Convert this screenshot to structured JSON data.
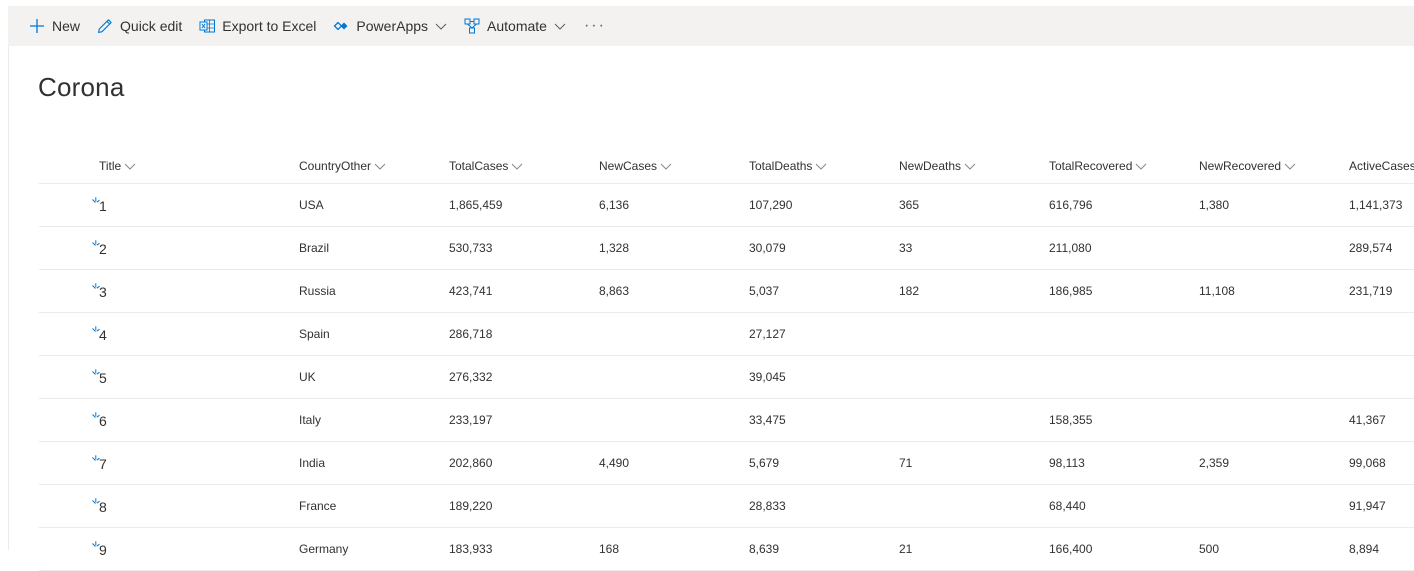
{
  "toolbar": {
    "new_label": "New",
    "quick_edit_label": "Quick edit",
    "export_label": "Export to Excel",
    "powerapps_label": "PowerApps",
    "automate_label": "Automate",
    "more_label": "···"
  },
  "list": {
    "title": "Corona",
    "columns": [
      "Title",
      "CountryOther",
      "TotalCases",
      "NewCases",
      "TotalDeaths",
      "NewDeaths",
      "TotalRecovered",
      "NewRecovered",
      "ActiveCases"
    ],
    "rows": [
      {
        "title": "1",
        "country": "USA",
        "total_cases": "1,865,459",
        "new_cases": "6,136",
        "total_deaths": "107,290",
        "new_deaths": "365",
        "total_recovered": "616,796",
        "new_recovered": "1,380",
        "active_cases": "1,141,373"
      },
      {
        "title": "2",
        "country": "Brazil",
        "total_cases": "530,733",
        "new_cases": "1,328",
        "total_deaths": "30,079",
        "new_deaths": "33",
        "total_recovered": "211,080",
        "new_recovered": "",
        "active_cases": "289,574"
      },
      {
        "title": "3",
        "country": "Russia",
        "total_cases": "423,741",
        "new_cases": "8,863",
        "total_deaths": "5,037",
        "new_deaths": "182",
        "total_recovered": "186,985",
        "new_recovered": "11,108",
        "active_cases": "231,719"
      },
      {
        "title": "4",
        "country": "Spain",
        "total_cases": "286,718",
        "new_cases": "",
        "total_deaths": "27,127",
        "new_deaths": "",
        "total_recovered": "",
        "new_recovered": "",
        "active_cases": ""
      },
      {
        "title": "5",
        "country": "UK",
        "total_cases": "276,332",
        "new_cases": "",
        "total_deaths": "39,045",
        "new_deaths": "",
        "total_recovered": "",
        "new_recovered": "",
        "active_cases": ""
      },
      {
        "title": "6",
        "country": "Italy",
        "total_cases": "233,197",
        "new_cases": "",
        "total_deaths": "33,475",
        "new_deaths": "",
        "total_recovered": "158,355",
        "new_recovered": "",
        "active_cases": "41,367"
      },
      {
        "title": "7",
        "country": "India",
        "total_cases": "202,860",
        "new_cases": "4,490",
        "total_deaths": "5,679",
        "new_deaths": "71",
        "total_recovered": "98,113",
        "new_recovered": "2,359",
        "active_cases": "99,068"
      },
      {
        "title": "8",
        "country": "France",
        "total_cases": "189,220",
        "new_cases": "",
        "total_deaths": "28,833",
        "new_deaths": "",
        "total_recovered": "68,440",
        "new_recovered": "",
        "active_cases": "91,947"
      },
      {
        "title": "9",
        "country": "Germany",
        "total_cases": "183,933",
        "new_cases": "168",
        "total_deaths": "8,639",
        "new_deaths": "21",
        "total_recovered": "166,400",
        "new_recovered": "500",
        "active_cases": "8,894"
      }
    ]
  },
  "icons": {
    "new": "plus-icon",
    "quick_edit": "pencil-icon",
    "export": "excel-icon",
    "powerapps": "powerapps-icon",
    "automate": "flow-icon",
    "new_item": "new-item-sparkle-icon",
    "chevron": "chevron-down-icon"
  },
  "colors": {
    "accent": "#0078d4",
    "command_bar_bg": "#f3f2f1",
    "divider": "#edebe9"
  }
}
